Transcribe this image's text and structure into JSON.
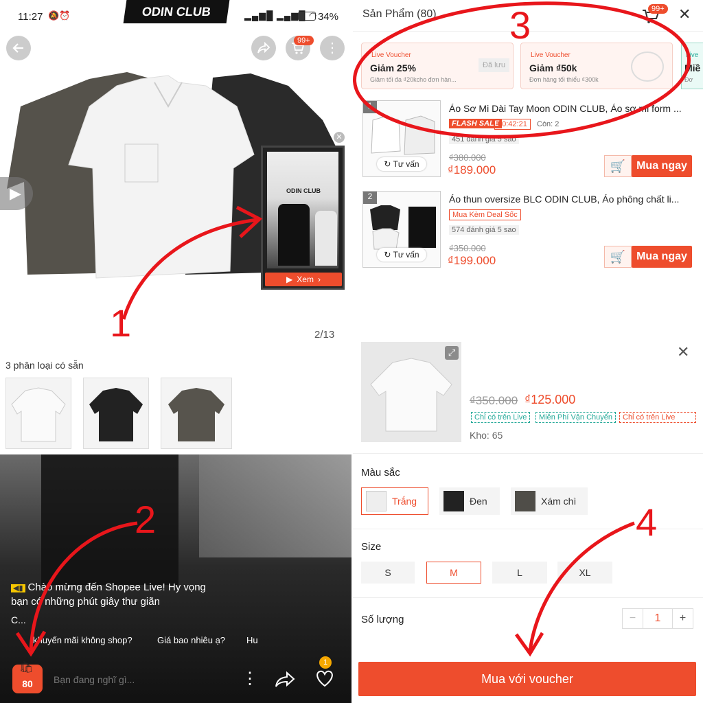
{
  "q1": {
    "time": "11:27",
    "battery": "34%",
    "brand": "ODIN CLUB",
    "cart_badge": "99+",
    "video_brand": "ODIN CLUB",
    "video_button": "Xem",
    "page_counter": "2/13",
    "annotation": "1"
  },
  "variants": {
    "title": "3 phân loại có sẵn"
  },
  "q2": {
    "welcome": "Chào mừng đến Shopee Live! Hy vọng bạn có những phút giây thư giãn",
    "welcome_more": "C...",
    "chips": [
      "khuyến mãi không shop?",
      "Giá bao nhiêu ạ?",
      "Hu"
    ],
    "bag_count": "80",
    "input_placeholder": "Bạn đang nghĩ gì...",
    "like_badge": "1",
    "annotation": "2"
  },
  "q3": {
    "header": "Sản Phẩm (80)",
    "cart_badge": "99+",
    "annotation": "3",
    "vouchers": [
      {
        "tag": "Live Voucher",
        "title": "Giảm 25%",
        "desc": "Giảm tối đa ₫20kcho đơn hàn...",
        "action": "Đã lưu"
      },
      {
        "tag": "Live Voucher",
        "title": "Giảm ₫50k",
        "desc": "Đơn hàng tối thiểu ₫300k",
        "action": ""
      },
      {
        "tag": "Live",
        "title": "Miề",
        "desc": "Đơ",
        "action": ""
      }
    ],
    "products": [
      {
        "index": "1",
        "name": "Áo Sơ Mi Dài Tay Moon ODIN CLUB, Áo sơ mi form ...",
        "flash_label": "FLASH SALE",
        "timer": "00:42:21",
        "stock": "Còn: 2",
        "rating": "451 đánh giá 5 sao",
        "old_price": "₫380.000",
        "price": "₫189.000",
        "consult": "Tư vấn",
        "buy": "Mua ngay"
      },
      {
        "index": "2",
        "name": "Áo thun oversize BLC ODIN CLUB, Áo phông chất li...",
        "deal_label": "Mua Kèm Deal Sốc",
        "rating": "574 đánh giá 5 sao",
        "old_price": "₫350.000",
        "price": "₫199.000",
        "consult": "Tư vấn",
        "buy": "Mua ngay"
      }
    ]
  },
  "q4": {
    "old_price": "₫350.000",
    "price": "₫125.000",
    "tag_live1": "Chỉ có trên Live",
    "tag_ship": "Miễn Phí Vận Chuyển",
    "tag_live2": "Chỉ có trên Live",
    "stock": "Kho: 65",
    "color_label": "Màu sắc",
    "colors": [
      "Trắng",
      "Đen",
      "Xám chì"
    ],
    "size_label": "Size",
    "sizes": [
      "S",
      "M",
      "L",
      "XL"
    ],
    "qty_label": "Số lượng",
    "qty": "1",
    "buy_voucher": "Mua với voucher",
    "annotation": "4"
  },
  "colors": {
    "accent": "#ee4d2d",
    "annotation": "#e8161b"
  }
}
